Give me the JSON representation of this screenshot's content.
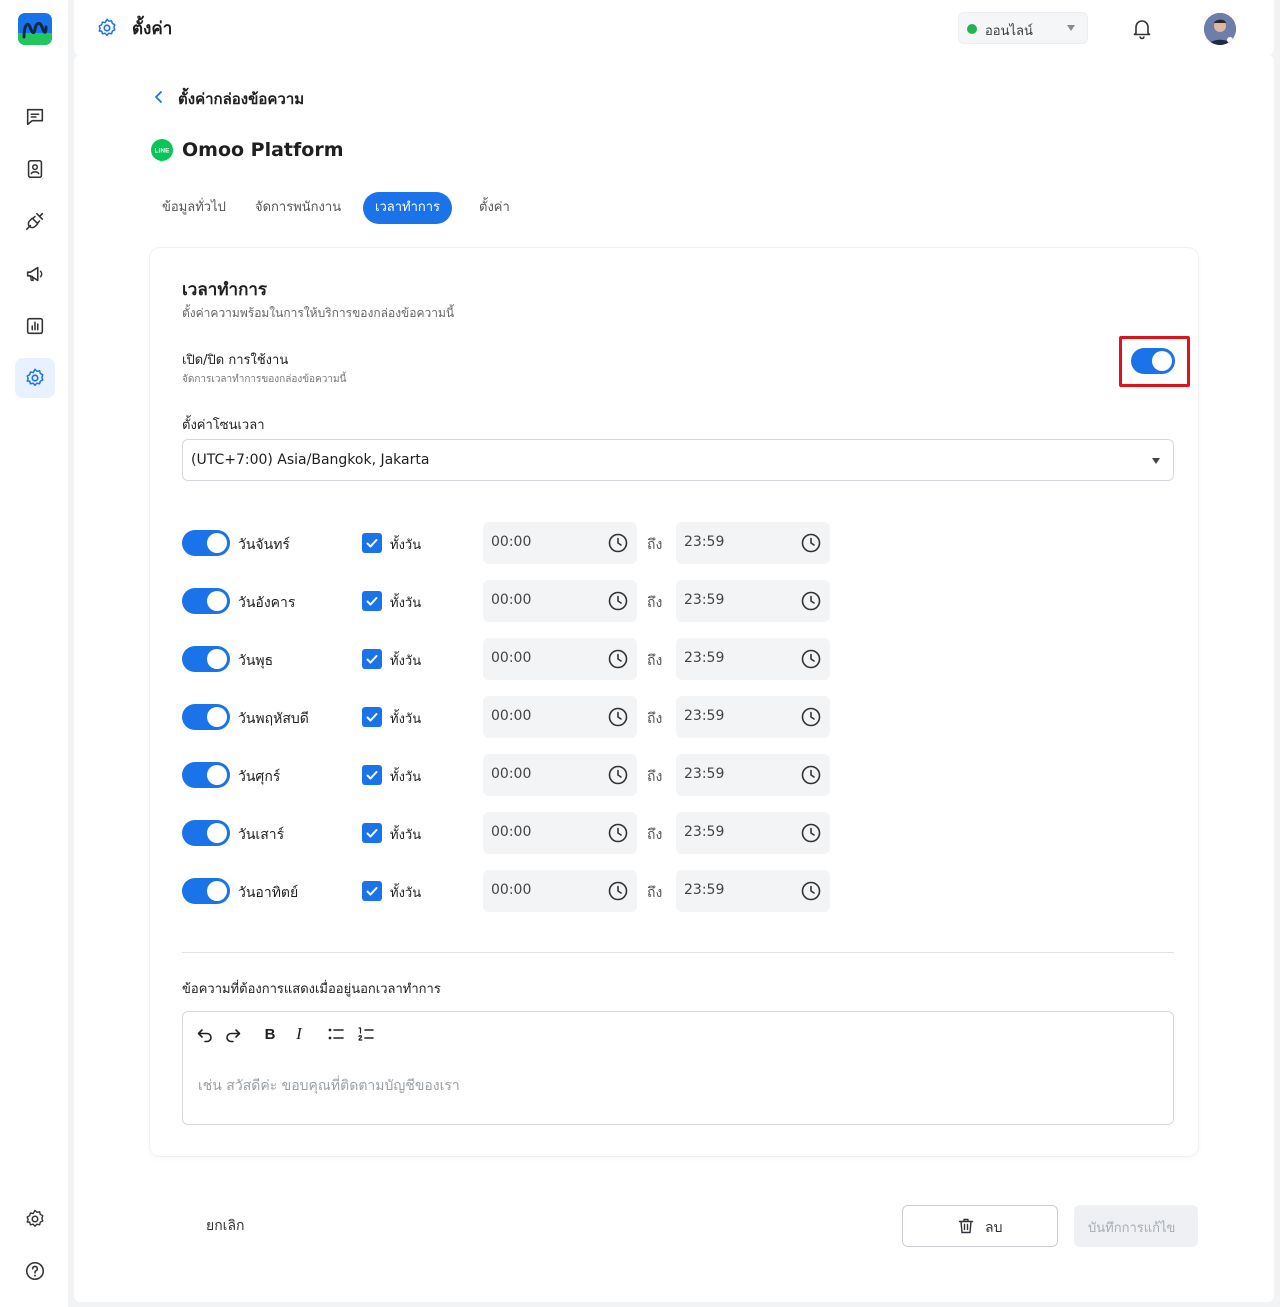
{
  "header": {
    "title": "ตั้งค่า",
    "status_label": "ออนไลน์",
    "status_color": "#20b455"
  },
  "sidebar": {
    "items": [
      {
        "icon": "chat-icon"
      },
      {
        "icon": "contacts-icon"
      },
      {
        "icon": "integration-icon"
      },
      {
        "icon": "megaphone-icon"
      },
      {
        "icon": "report-icon"
      },
      {
        "icon": "settings-icon",
        "active": true
      }
    ],
    "bottom": [
      {
        "icon": "gear-icon"
      },
      {
        "icon": "help-icon"
      }
    ]
  },
  "page": {
    "breadcrumb": "ตั้งค่ากล่องข้อความ",
    "platform_name": "Omoo Platform",
    "line_badge": "LINE",
    "tabs": [
      {
        "label": "ข้อมูลทั่วไป",
        "active": false
      },
      {
        "label": "จัดการพนักงาน",
        "active": false
      },
      {
        "label": "เวลาทำการ",
        "active": true
      },
      {
        "label": "ตั้งค่า",
        "active": false
      }
    ]
  },
  "card": {
    "title": "เวลาทำการ",
    "subtitle": "ตั้งค่าความพร้อมในการให้บริการของกล่องข้อความนี้",
    "enable_label": "เปิด/ปิด การใช้งาน",
    "enable_sub": "จัดการเวลาทำการของกล่องข้อความนี้",
    "enabled": true,
    "timezone_label": "ตั้งค่าโซนเวลา",
    "timezone_value": "(UTC+7:00) Asia/Bangkok, Jakarta",
    "to_label": "ถึง",
    "allday_label": "ทั้งวัน",
    "days": [
      {
        "name": "วันจันทร์",
        "enabled": true,
        "all_day": true,
        "start": "00:00",
        "end": "23:59"
      },
      {
        "name": "วันอังคาร",
        "enabled": true,
        "all_day": true,
        "start": "00:00",
        "end": "23:59"
      },
      {
        "name": "วันพุธ",
        "enabled": true,
        "all_day": true,
        "start": "00:00",
        "end": "23:59"
      },
      {
        "name": "วันพฤหัสบดี",
        "enabled": true,
        "all_day": true,
        "start": "00:00",
        "end": "23:59"
      },
      {
        "name": "วันศุกร์",
        "enabled": true,
        "all_day": true,
        "start": "00:00",
        "end": "23:59"
      },
      {
        "name": "วันเสาร์",
        "enabled": true,
        "all_day": true,
        "start": "00:00",
        "end": "23:59"
      },
      {
        "name": "วันอาทิตย์",
        "enabled": true,
        "all_day": true,
        "start": "00:00",
        "end": "23:59"
      }
    ],
    "message_label": "ข้อความที่ต้องการแสดงเมื่ออยู่นอกเวลาทำการ",
    "message_placeholder": "เช่น สวัสดีค่ะ ขอบคุณที่ติดตามบัญชีของเรา",
    "toolbar": {
      "bold": "B",
      "italic": "I"
    }
  },
  "footer": {
    "cancel_label": "ยกเลิก",
    "delete_label": "ลบ",
    "save_label": "บันทึกการแก้ไข"
  },
  "colors": {
    "accent": "#1a73e8",
    "highlight": "#e0131d",
    "line_green": "#06c755"
  }
}
